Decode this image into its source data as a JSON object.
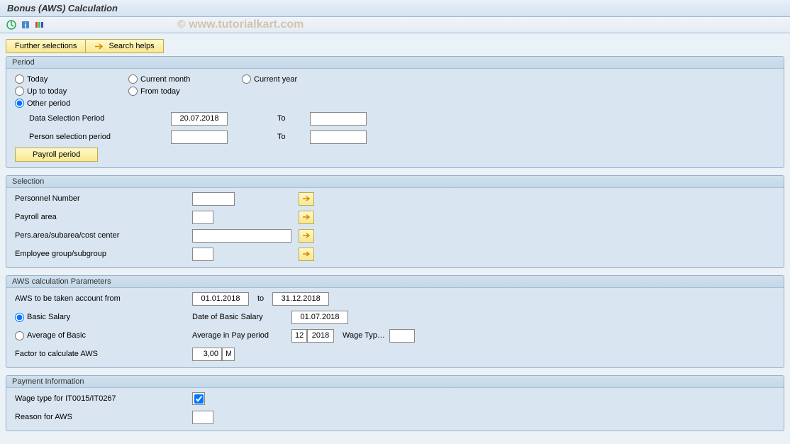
{
  "header": {
    "title": "Bonus (AWS) Calculation"
  },
  "watermark": "© www.tutorialkart.com",
  "actions": {
    "further_selections": "Further selections",
    "search_helps": "Search helps"
  },
  "period": {
    "title": "Period",
    "today": "Today",
    "current_month": "Current month",
    "current_year": "Current year",
    "up_to_today": "Up to today",
    "from_today": "From today",
    "other_period": "Other period",
    "data_selection_period": "Data Selection Period",
    "data_selection_value": "20.07.2018",
    "person_selection_period": "Person selection period",
    "to": "To",
    "payroll_period": "Payroll period"
  },
  "selection": {
    "title": "Selection",
    "personnel_number": "Personnel Number",
    "payroll_area": "Payroll area",
    "pers_area": "Pers.area/subarea/cost center",
    "employee_group": "Employee group/subgroup"
  },
  "aws": {
    "title": "AWS calculation Parameters",
    "aws_account_from": "AWS to be taken account from",
    "aws_from_value": "01.01.2018",
    "to": "to",
    "aws_to_value": "31.12.2018",
    "basic_salary": "Basic Salary",
    "date_basic_salary": "Date of Basic Salary",
    "date_basic_value": "01.07.2018",
    "average_basic": "Average of Basic",
    "average_pay_period": "Average in Pay period",
    "avg_month": "12",
    "avg_year": "2018",
    "wage_typ": "Wage Typ…",
    "factor_calculate": "Factor to calculate AWS",
    "factor_value": "3,00",
    "factor_unit": "M"
  },
  "payment": {
    "title": "Payment Information",
    "wage_type_it": "Wage type for IT0015/IT0267",
    "reason_aws": "Reason for AWS"
  }
}
